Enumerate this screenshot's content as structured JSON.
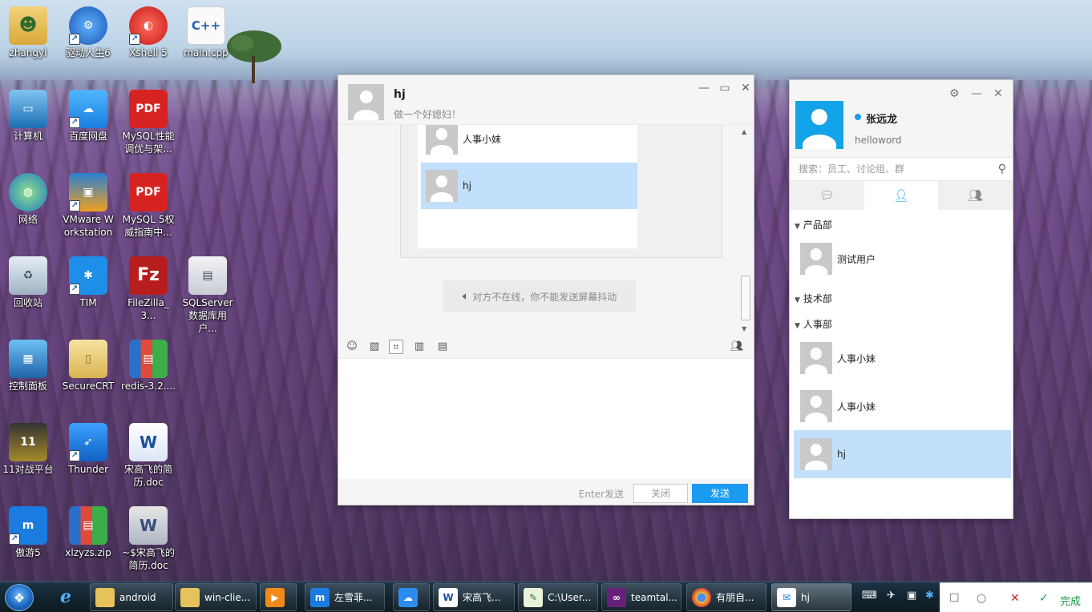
{
  "desktop": {
    "icons": [
      {
        "label": "zhangyl"
      },
      {
        "label": "驱动人生6"
      },
      {
        "label": "Xshell 5"
      },
      {
        "label": "main.cpp"
      },
      {
        "label": "计算机"
      },
      {
        "label": "百度网盘"
      },
      {
        "label": "MySQL性能调优与架..."
      },
      {
        "label": "网络"
      },
      {
        "label": "VMware Workstation"
      },
      {
        "label": "MySQL 5权威指南中..."
      },
      {
        "label": "回收站"
      },
      {
        "label": "TIM"
      },
      {
        "label": "FileZilla_3..."
      },
      {
        "label": "SQLServer数据库用户..."
      },
      {
        "label": "控制面板"
      },
      {
        "label": "SecureCRT"
      },
      {
        "label": "redis-3.2...."
      },
      {
        "label": "11对战平台"
      },
      {
        "label": "Thunder"
      },
      {
        "label": "宋高飞的简历.doc"
      },
      {
        "label": "傲游5"
      },
      {
        "label": "xlzyzs.zip"
      },
      {
        "label": "~$宋高飞的简历.doc"
      }
    ],
    "icon_glyphs": {
      "cpp": "C++",
      "pdf": "PDF",
      "fz": "Fz",
      "word": "W"
    }
  },
  "chat": {
    "name": "hj",
    "signature": "做一个好媳妇！",
    "members": [
      {
        "name": "人事小妹"
      },
      {
        "name": "hj"
      }
    ],
    "notice": "对方不在线，你不能发送屏幕抖动",
    "enter_hint": "Enter发送",
    "close_label": "关闭",
    "send_label": "发送"
  },
  "panel": {
    "user_name": "张远龙",
    "user_sig": "helloword",
    "search_placeholder": "搜索：员工、讨论组、群",
    "groups": [
      {
        "name": "产品部",
        "members": [
          "测试用户"
        ]
      },
      {
        "name": "技术部",
        "members": []
      },
      {
        "name": "人事部",
        "members": [
          "人事小妹",
          "人事小妹",
          "hj"
        ]
      }
    ]
  },
  "taskbar": {
    "buttons": [
      {
        "label": "android"
      },
      {
        "label": "win-clie..."
      },
      {
        "label": "左雪菲..."
      },
      {
        "label": "宋高飞..."
      },
      {
        "label": "C:\\User..."
      },
      {
        "label": "teamtal..."
      },
      {
        "label": "有朋自..."
      },
      {
        "label": "hj"
      }
    ],
    "done_label": "完成"
  },
  "colors": {
    "accent": "#1a9bf1",
    "selection": "#c2dffb",
    "avatar_gray": "#c9c9c9"
  }
}
